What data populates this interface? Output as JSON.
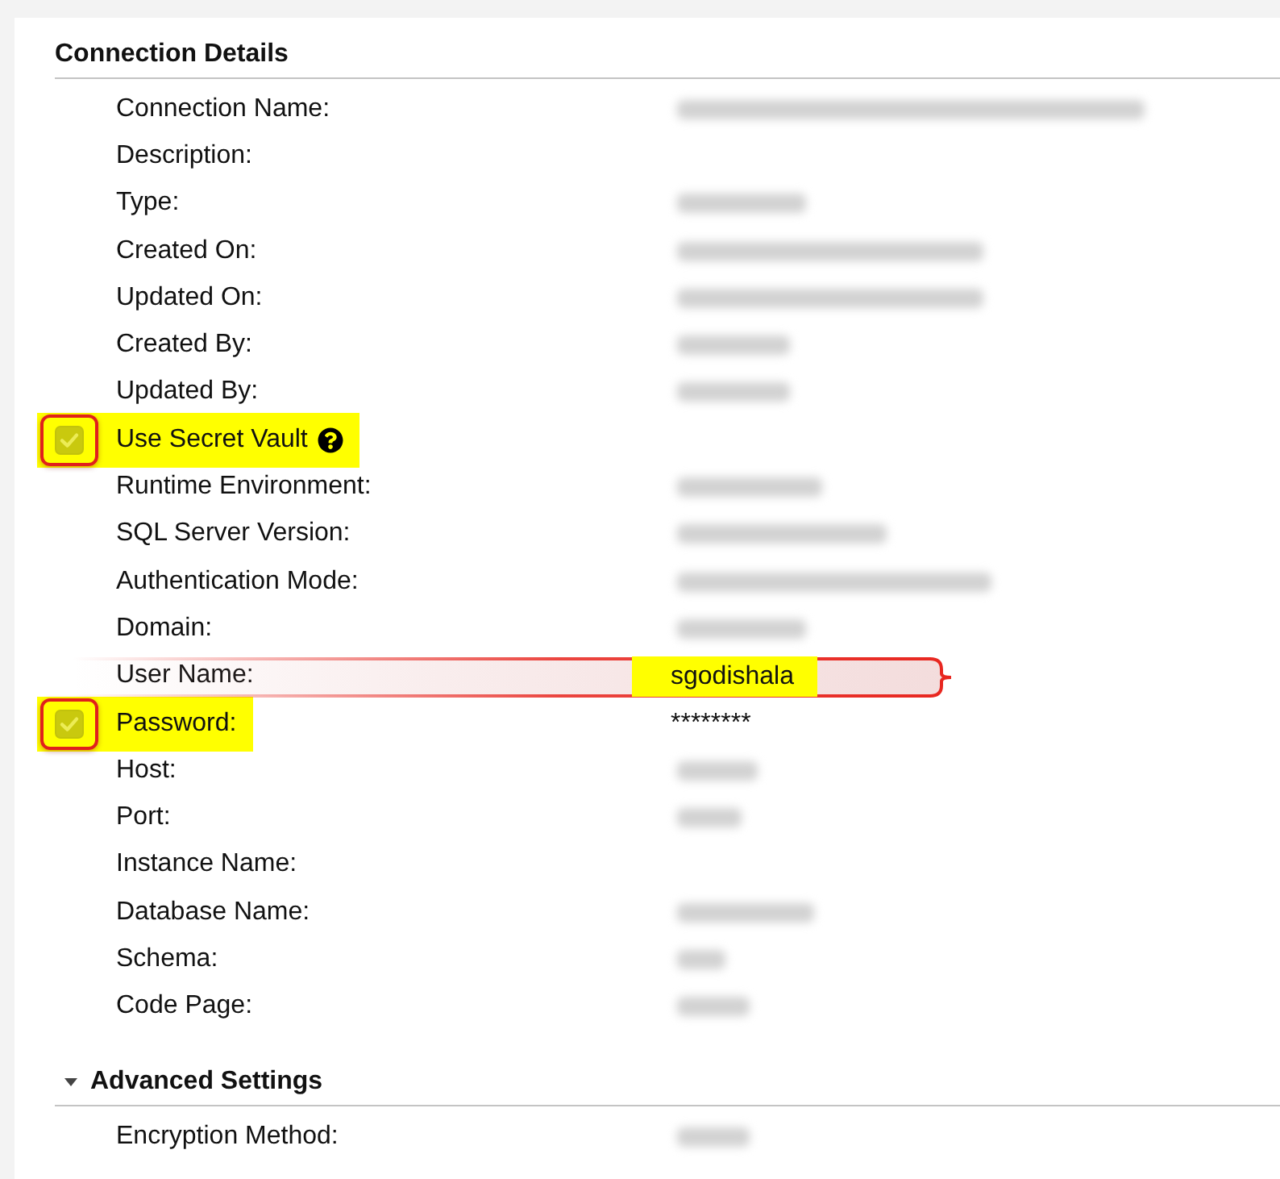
{
  "sections": [
    {
      "kind": "plain",
      "title": "Connection Details",
      "fields": [
        {
          "kind": "text",
          "label": "Connection Name:",
          "redacted": true
        },
        {
          "kind": "text",
          "label": "Description:"
        },
        {
          "kind": "text",
          "label": "Type:",
          "redacted": true
        },
        {
          "kind": "text",
          "label": "Created On:",
          "redacted": true
        },
        {
          "kind": "text",
          "label": "Updated On:",
          "redacted": true
        },
        {
          "kind": "text",
          "label": "Created By:",
          "redacted": true
        },
        {
          "kind": "text",
          "label": "Updated By:",
          "redacted": true
        },
        {
          "kind": "checkbox",
          "label": "Use Secret Vault",
          "checked": true,
          "help": true,
          "highlight": true,
          "checkbox_outline": true
        },
        {
          "kind": "text",
          "label": "Runtime Environment:",
          "redacted": true
        },
        {
          "kind": "text",
          "label": "SQL Server Version:",
          "redacted": true
        },
        {
          "kind": "text",
          "label": "Authentication Mode:",
          "redacted": true
        },
        {
          "kind": "text",
          "label": "Domain:",
          "redacted": true
        },
        {
          "kind": "text",
          "label": "User Name:",
          "value": "sgodishala",
          "value_highlight": true,
          "callout": true
        },
        {
          "kind": "checkbox",
          "label": "Password:",
          "checked": true,
          "value": "********",
          "highlight": true,
          "checkbox_outline": true
        },
        {
          "kind": "text",
          "label": "Host:",
          "redacted": true
        },
        {
          "kind": "text",
          "label": "Port:",
          "redacted": true
        },
        {
          "kind": "text",
          "label": "Instance Name:"
        },
        {
          "kind": "text",
          "label": "Database Name:",
          "redacted": true
        },
        {
          "kind": "text",
          "label": "Schema:",
          "redacted": true
        },
        {
          "kind": "text",
          "label": "Code Page:",
          "redacted": true
        }
      ]
    },
    {
      "kind": "collapsible",
      "title": "Advanced Settings",
      "expanded": true,
      "fields": [
        {
          "kind": "text",
          "label": "Encryption Method:",
          "redacted": true
        }
      ]
    }
  ]
}
